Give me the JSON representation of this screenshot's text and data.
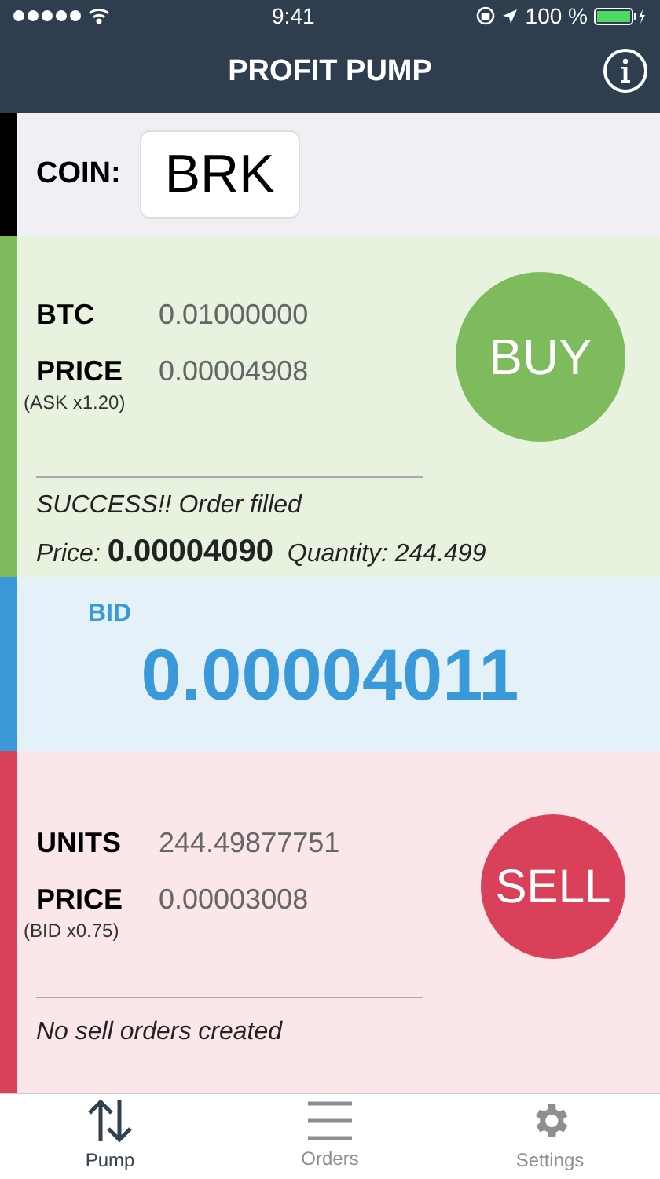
{
  "status_bar": {
    "time": "9:41",
    "battery": "100 %"
  },
  "nav": {
    "title": "PROFIT PUMP"
  },
  "coin": {
    "label": "COIN:",
    "value": "BRK"
  },
  "buy": {
    "rows": [
      {
        "label": "BTC",
        "value": "0.01000000"
      },
      {
        "label": "PRICE",
        "sublabel": "(ASK x1.20)",
        "value": "0.00004908"
      }
    ],
    "button": "BUY",
    "status": "SUCCESS!! Order filled",
    "detail": "Price: **0.00004090**  Quantity: 244.499"
  },
  "bid": {
    "label": "BID",
    "value": "0.00004011"
  },
  "sell": {
    "rows": [
      {
        "label": "UNITS",
        "value": "244.49877751"
      },
      {
        "label": "PRICE",
        "sublabel": "(BID x0.75)",
        "value": "0.00003008"
      }
    ],
    "button": "SELL",
    "status": "No sell orders created"
  },
  "tabs": [
    {
      "label": "Pump",
      "kind": "pump",
      "selected": true
    },
    {
      "label": "Orders",
      "kind": "orders",
      "selected": false
    },
    {
      "label": "Settings",
      "kind": "settings",
      "selected": false
    }
  ]
}
